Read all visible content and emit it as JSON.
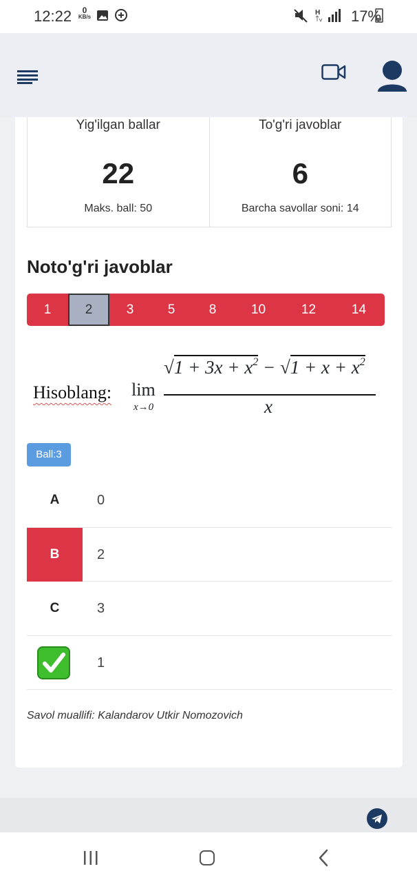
{
  "status_bar": {
    "time": "12:22",
    "net_speed_value": "0",
    "net_speed_unit": "KB/s",
    "network_type": "H",
    "battery_percent": "17%"
  },
  "stats": {
    "points": {
      "label": "Yig'ilgan ballar",
      "value": "22",
      "sub": "Maks. ball: 50"
    },
    "correct": {
      "label": "To'g'ri javoblar",
      "value": "6",
      "sub": "Barcha savollar soni: 14"
    }
  },
  "wrong_answers": {
    "title": "Noto'g'ri javoblar",
    "pages": [
      "1",
      "2",
      "3",
      "5",
      "8",
      "10",
      "12",
      "14"
    ],
    "active_page": "2"
  },
  "question": {
    "label": "Hisoblang:",
    "lim": "lim",
    "lim_sub": "x→0",
    "denominator": "x",
    "points_badge": "Ball:3"
  },
  "options": [
    {
      "key": "A",
      "value": "0",
      "state": "normal"
    },
    {
      "key": "B",
      "value": "2",
      "state": "wrong"
    },
    {
      "key": "C",
      "value": "3",
      "state": "normal"
    },
    {
      "key": "check-icon",
      "value": "1",
      "state": "correct"
    }
  ],
  "author": "Savol muallifi: Kalandarov Utkir Nomozovich",
  "colors": {
    "accent_red": "#dc3545",
    "active_page_bg": "#a9b0c1",
    "badge_blue": "#5b9be0",
    "header_icon_blue": "#1d3a63",
    "correct_green": "#3ebd2d"
  }
}
